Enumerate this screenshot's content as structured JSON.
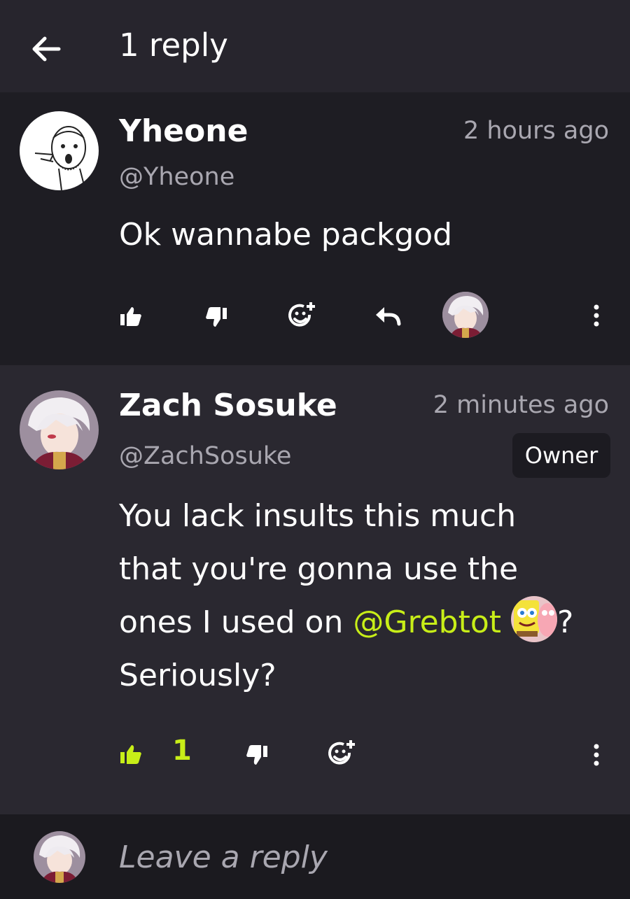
{
  "header": {
    "title": "1 reply",
    "back_icon": "back-arrow-icon"
  },
  "parent_comment": {
    "author": "Yheone",
    "handle": "@Yheone",
    "time": "2 hours ago",
    "text": "Ok wannabe packgod",
    "actions": [
      "thumbs-up-icon",
      "thumbs-down-icon",
      "add-reaction-icon",
      "reply-icon",
      "more-icon"
    ]
  },
  "reply_comment": {
    "author": "Zach Sosuke",
    "handle": "@ZachSosuke",
    "time": "2 minutes ago",
    "badge": "Owner",
    "text_line1": "You lack insults this much",
    "text_line2": "that you're gonna use the",
    "text_line3_before": "ones I used on ",
    "mention": "@Grebtot",
    "text_line3_after": "?",
    "text_line4": "Seriously?",
    "like_count": "1"
  },
  "reply_input": {
    "placeholder": "Leave a reply"
  },
  "colors": {
    "accent": "#c8ee18",
    "background": "#26242c",
    "muted": "#a9a7b0"
  }
}
